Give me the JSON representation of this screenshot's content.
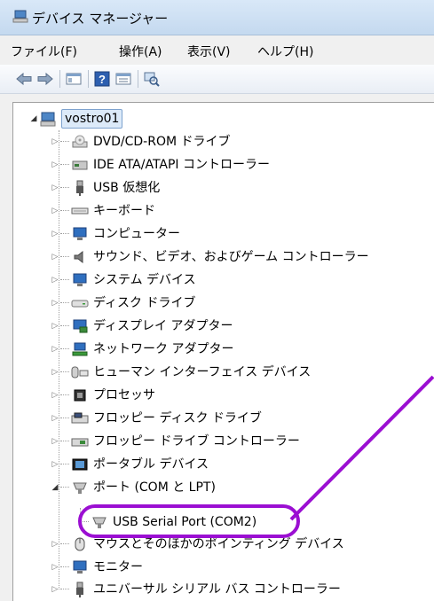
{
  "window": {
    "title": "デバイス マネージャー"
  },
  "menu": [
    "ファイル(F)",
    "操作(A)",
    "表示(V)",
    "ヘルプ(H)"
  ],
  "tree": {
    "root": {
      "label": "vostro01",
      "icon": "computer-icon",
      "expanded": true
    },
    "items": [
      {
        "label": "DVD/CD-ROM ドライブ",
        "icon": "dvd-drive-icon"
      },
      {
        "label": "IDE ATA/ATAPI コントローラー",
        "icon": "ide-controller-icon"
      },
      {
        "label": "USB 仮想化",
        "icon": "usb-plug-icon"
      },
      {
        "label": "キーボード",
        "icon": "keyboard-icon"
      },
      {
        "label": "コンピューター",
        "icon": "computer-monitor-icon"
      },
      {
        "label": "サウンド、ビデオ、およびゲーム コントローラー",
        "icon": "speaker-icon"
      },
      {
        "label": "システム デバイス",
        "icon": "system-device-icon"
      },
      {
        "label": "ディスク ドライブ",
        "icon": "disk-drive-icon"
      },
      {
        "label": "ディスプレイ アダプター",
        "icon": "display-adapter-icon"
      },
      {
        "label": "ネットワーク アダプター",
        "icon": "network-adapter-icon"
      },
      {
        "label": "ヒューマン インターフェイス デバイス",
        "icon": "hid-icon"
      },
      {
        "label": "プロセッサ",
        "icon": "processor-icon"
      },
      {
        "label": "フロッピー ディスク ドライブ",
        "icon": "floppy-drive-icon"
      },
      {
        "label": "フロッピー ドライブ コントローラー",
        "icon": "floppy-controller-icon"
      },
      {
        "label": "ポータブル デバイス",
        "icon": "portable-device-icon"
      },
      {
        "label": "ポート (COM と LPT)",
        "icon": "port-icon",
        "expanded": true,
        "children": [
          {
            "label": "USB Serial Port (COM2)",
            "icon": "port-icon"
          }
        ]
      },
      {
        "label": "マウスとそのほかのポインティング デバイス",
        "icon": "mouse-icon"
      },
      {
        "label": "モニター",
        "icon": "monitor-icon"
      },
      {
        "label": "ユニバーサル シリアル バス コントローラー",
        "icon": "usb-plug-icon"
      }
    ]
  },
  "colors": {
    "highlight": "#9b0fd2",
    "title_bar": "#d3e3f5",
    "selection": "#dceaf9"
  }
}
